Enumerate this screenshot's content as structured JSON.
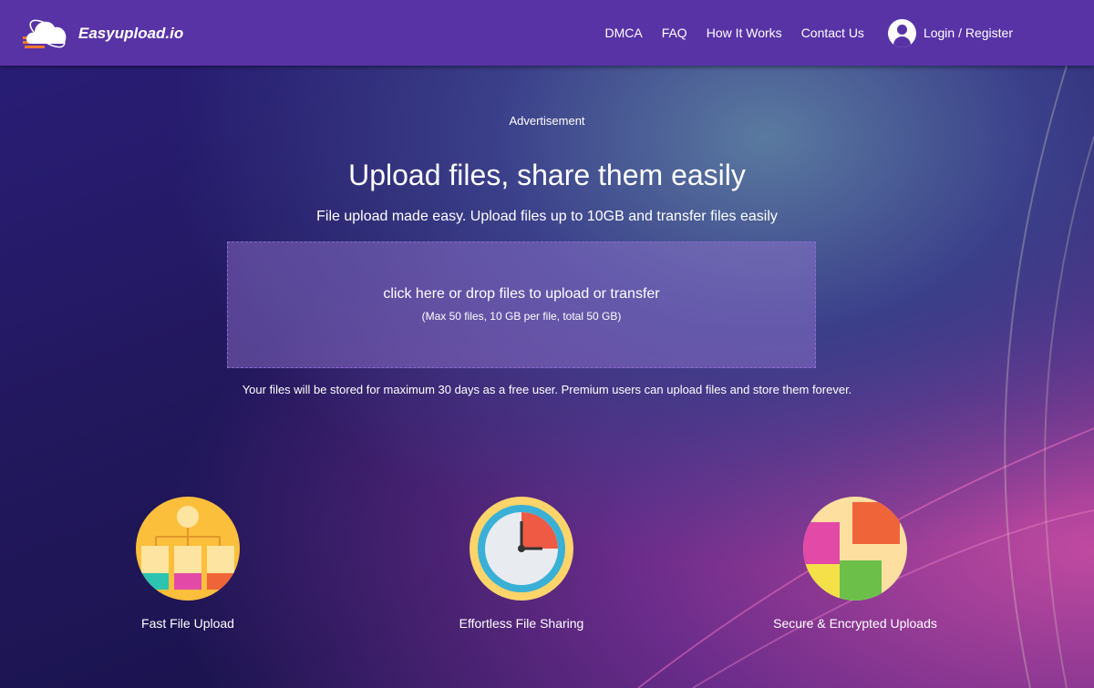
{
  "header": {
    "logo_text": "Easyupload.io",
    "nav": [
      "DMCA",
      "FAQ",
      "How It Works",
      "Contact Us"
    ],
    "login": "Login / Register"
  },
  "main": {
    "advertisement": "Advertisement",
    "title": "Upload files, share them easily",
    "subtitle": "File upload made easy. Upload files up to 10GB and transfer files easily",
    "dropzone": {
      "text": "click here or drop files to upload or transfer",
      "limits": "(Max 50 files, 10 GB per file, total 50 GB)"
    },
    "storage_note": "Your files will be stored for maximum 30 days as a free user. Premium users can upload files and store them forever."
  },
  "features": [
    {
      "label": "Fast File Upload",
      "icon": "sitemap-icon"
    },
    {
      "label": "Effortless File Sharing",
      "icon": "clock-icon"
    },
    {
      "label": "Secure & Encrypted Uploads",
      "icon": "puzzle-icon"
    }
  ]
}
